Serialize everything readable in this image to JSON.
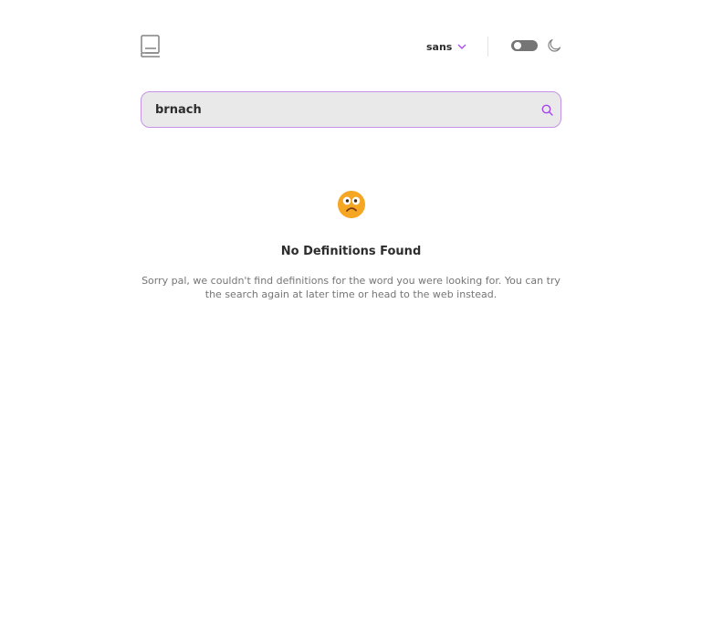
{
  "header": {
    "logo_icon": "book-icon",
    "font_selector": {
      "selected": "sans",
      "chevron_icon": "chevron-down-icon"
    },
    "theme_toggle_icon": "toggle-icon",
    "dark_mode_icon": "moon-icon"
  },
  "search": {
    "value": "brnach",
    "icon": "search-icon"
  },
  "empty_state": {
    "emoji_icon": "confused-face-icon",
    "title": "No Definitions Found",
    "message_line1": "Sorry pal, we couldn't find definitions for the word you were looking for. You can try",
    "message_line2": "the search again at later time or head to the web instead."
  },
  "colors": {
    "accent": "#a445ed",
    "search_border": "#c493e8",
    "search_bg": "#e9e9e9",
    "toggle_bg": "#757575",
    "text_primary": "#2d2d2d",
    "text_secondary": "#757575",
    "emoji": "#f5a623"
  }
}
